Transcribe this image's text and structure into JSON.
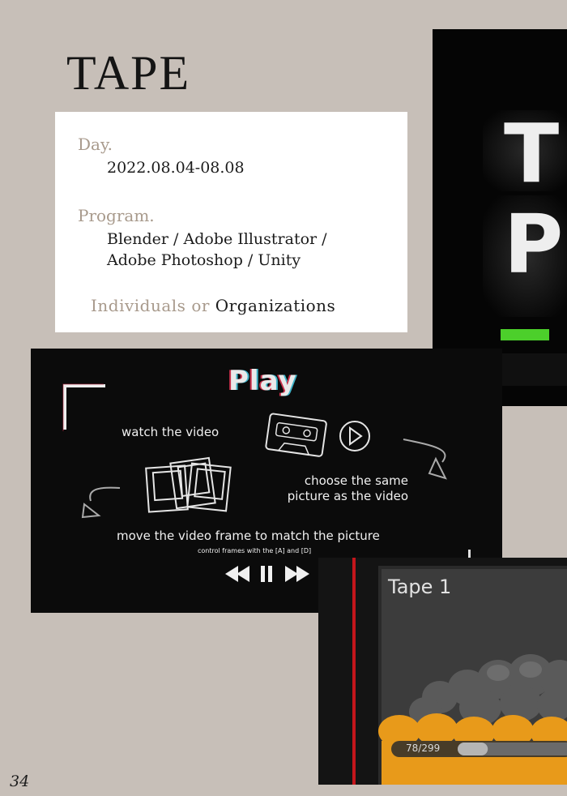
{
  "title": "TAPE",
  "info": {
    "day_label": "Day.",
    "day_value": "2022.08.04-08.08",
    "program_label": "Program.",
    "program_line1": "Blender / Adobe Illustrator /",
    "program_line2": "Adobe Photoshop / Unity",
    "footer_individuals": "Individuals",
    "footer_or": "or",
    "footer_organizations": "Organizations"
  },
  "play_screen": {
    "title": "Play",
    "watch": "watch the video",
    "choose_line1": "choose the same",
    "choose_line2": "picture as the video",
    "move": "move the video frame to match the picture",
    "control": "control frames with the [A] and [D]"
  },
  "game_screen": {
    "tape_label": "Tape 1",
    "progress_text": "78/299",
    "progress": 0.26
  },
  "render_letters": [
    "T",
    "P"
  ],
  "page_number": "34",
  "colors": {
    "background": "#c7bfb8",
    "accent_gray": "#a89a8c",
    "panel": "#0b0b0b",
    "green": "#4ccf2b",
    "orange": "#e89a1a",
    "red": "#c4161c"
  }
}
